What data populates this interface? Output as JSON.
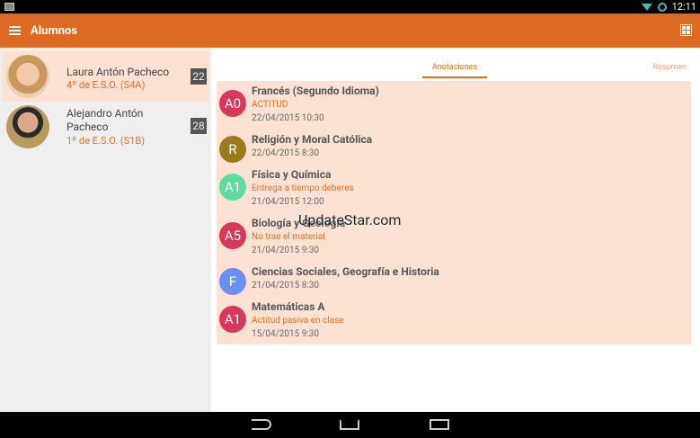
{
  "status": {
    "time": "12:11"
  },
  "appbar": {
    "title": "Alumnos"
  },
  "students": [
    {
      "name": "Laura Antón Pacheco",
      "group": "4º de E.S.O. (S4A)",
      "count": "22"
    },
    {
      "name": "Alejandro Antón Pacheco",
      "group": "1º de E.S.O. (S1B)",
      "count": "28"
    }
  ],
  "tabs": {
    "active": "Anotaciones",
    "other": "Resumen"
  },
  "annotations": [
    {
      "badge": "A0",
      "color": "#d8375a",
      "subject": "Francés (Segundo Idioma)",
      "note": "ACTITUD",
      "date": "22/04/2015 10:30"
    },
    {
      "badge": "R",
      "color": "#9b7a1c",
      "subject": "Religión y Moral Católica",
      "note": null,
      "date": "22/04/2015 8:30"
    },
    {
      "badge": "A1",
      "color": "#5edc9f",
      "subject": "Física y Química",
      "note": "Entrega a tiempo deberes",
      "date": "21/04/2015 12:00"
    },
    {
      "badge": "A5",
      "color": "#d8375a",
      "subject": "Biología y Geología",
      "note": "No trae el material",
      "date": "21/04/2015 9:30"
    },
    {
      "badge": "F",
      "color": "#6b8ef0",
      "subject": "Ciencias Sociales, Geografía e Historia",
      "note": null,
      "date": "21/04/2015 8:30"
    },
    {
      "badge": "A1",
      "color": "#d8375a",
      "subject": "Matemáticas A",
      "note": "Actitud pasiva en clase",
      "date": "15/04/2015 9:30"
    }
  ],
  "watermark": "UpdateStar.com"
}
